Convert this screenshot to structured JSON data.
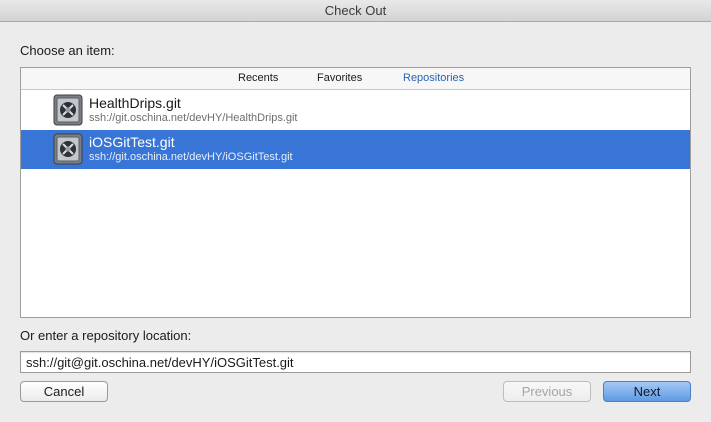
{
  "window": {
    "title": "Check Out"
  },
  "chooser": {
    "label": "Choose an item:",
    "tabs": [
      {
        "label": "Recents",
        "selected": false
      },
      {
        "label": "Favorites",
        "selected": false
      },
      {
        "label": "Repositories",
        "selected": true
      }
    ],
    "items": [
      {
        "name": "HealthDrips.git",
        "url": "ssh://git.oschina.net/devHY/HealthDrips.git",
        "icon": "git-repository-icon",
        "selected": false
      },
      {
        "name": "iOSGitTest.git",
        "url": "ssh://git.oschina.net/devHY/iOSGitTest.git",
        "icon": "git-repository-icon",
        "selected": true
      }
    ]
  },
  "location": {
    "label": "Or enter a repository location:",
    "value": "ssh://git@git.oschina.net/devHY/iOSGitTest.git"
  },
  "buttons": {
    "cancel": "Cancel",
    "previous": "Previous",
    "next": "Next"
  },
  "colors": {
    "selection": "#3875d7",
    "selected_tab": "#2864b4",
    "default_button": "#5e9ae3"
  }
}
